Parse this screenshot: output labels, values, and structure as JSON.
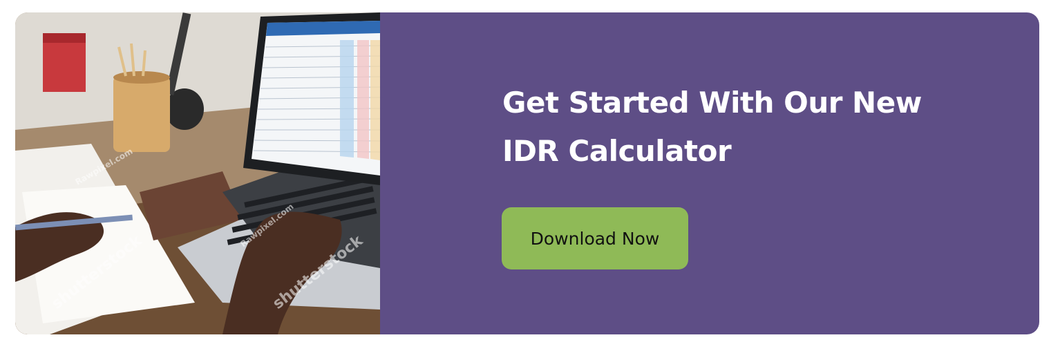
{
  "banner": {
    "photo": {
      "description_icon": "laptop-spreadsheet-photo",
      "watermarks": [
        "shutterstock",
        "shutterstock",
        "shutterstock",
        "Rawpixel.com",
        "Rawpixel.com",
        "Rawpixel.com"
      ]
    },
    "headline": "Get Started With Our New IDR Calculator",
    "cta_label": "Download Now"
  },
  "colors": {
    "panel": "#5e4e86",
    "button": "#8fba57",
    "headline_text": "#ffffff",
    "button_text": "#111111"
  }
}
